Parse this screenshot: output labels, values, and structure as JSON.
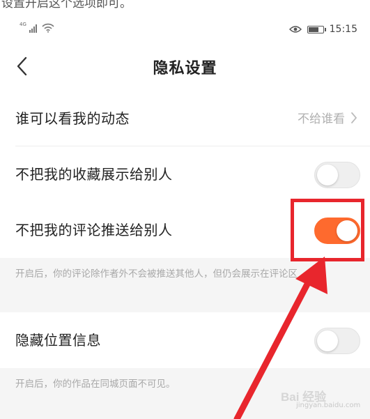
{
  "caption_strip": "设置开启这个选项即可。",
  "status_bar": {
    "network_label": "4G",
    "time": "15:15",
    "battery_level": 0.7
  },
  "nav": {
    "title": "隐私设置"
  },
  "rows": [
    {
      "label": "谁可以看我的动态",
      "value": "不给谁看"
    },
    {
      "label": "不把我的收藏展示给别人",
      "toggle_on": false
    },
    {
      "label": "不把我的评论推送给别人",
      "toggle_on": true
    },
    {
      "label": "隐藏位置信息",
      "toggle_on": false
    }
  ],
  "hints": {
    "comment_hint": "开启后，你的评论除作者外不会被推送其他人，但仍会展示在评论区",
    "location_hint": "开启后，你的作品在同城页面不可见。"
  },
  "watermark": {
    "main": "Bai 经验",
    "sub": "jingyan.baidu.com"
  },
  "colors": {
    "accent_orange": "#fe6a2e",
    "highlight_red": "#e8262d"
  }
}
